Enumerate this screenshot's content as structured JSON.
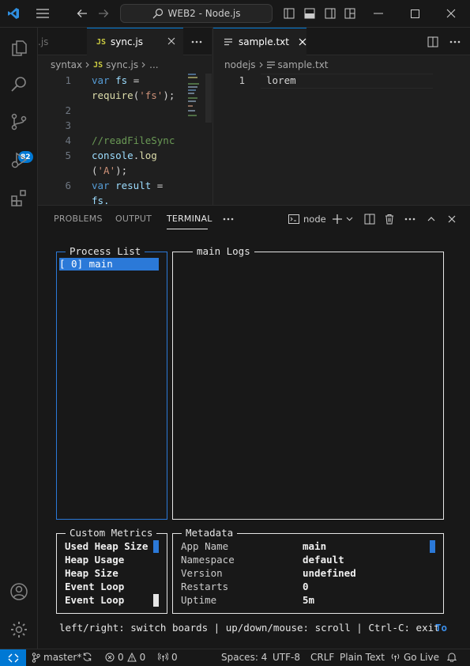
{
  "titlebar": {
    "search_text": "WEB2 - Node.js"
  },
  "activity": {
    "scm_badge": "82"
  },
  "editor1": {
    "tabs": [
      {
        "label": ".js"
      },
      {
        "icon": "JS",
        "label": "sync.js"
      }
    ],
    "breadcrumb": {
      "folder": "syntax",
      "file": "sync.js",
      "more": "..."
    },
    "line_numbers": [
      "1",
      "2",
      "3",
      "4",
      "5",
      "6"
    ],
    "code": {
      "l1a": "var",
      "l1b": " fs ",
      "l1c": "=",
      "l1d": "require",
      "l1e": "(",
      "l1f": "'fs'",
      "l1g": ");",
      "l4": "//readFileSync",
      "l5a": "console",
      "l5b": ".",
      "l5c": "log",
      "l5d": "(",
      "l5e": "'A'",
      "l5f": ");",
      "l6a": "var",
      "l6b": " result ",
      "l6c": "=",
      "l6d": "fs."
    }
  },
  "editor2": {
    "tab_label": "sample.txt",
    "breadcrumb": {
      "folder": "nodejs",
      "file": "sample.txt"
    },
    "line_number": "1",
    "content": "lorem"
  },
  "panel": {
    "tabs": [
      "PROBLEMS",
      "OUTPUT",
      "TERMINAL"
    ],
    "active_tab": "TERMINAL",
    "terminal_name": "node"
  },
  "terminal": {
    "process_list_title": "Process List",
    "process_item": "[ 0] main",
    "logs_title": "main Logs",
    "metrics_title": "Custom Metrics",
    "metrics": [
      "Used Heap Size",
      "Heap Usage",
      "Heap Size",
      "Event Loop",
      "Event Loop"
    ],
    "metadata_title": "Metadata",
    "metadata": [
      {
        "key": "App Name",
        "value": "main"
      },
      {
        "key": "Namespace",
        "value": "default"
      },
      {
        "key": "Version",
        "value": "undefined"
      },
      {
        "key": "Restarts",
        "value": "0"
      },
      {
        "key": "Uptime",
        "value": "5m"
      }
    ],
    "help": "left/right: switch boards | up/down/mouse: scroll | Ctrl-C: exit",
    "help_tail": "To"
  },
  "statusbar": {
    "branch": "master*",
    "errors": "0",
    "warnings": "0",
    "ports": "0",
    "spaces": "Spaces: 4",
    "encoding": "UTF-8",
    "eol": "CRLF",
    "language": "Plain Text",
    "golive": "Go Live"
  },
  "colors": {
    "accent": "#0078d4",
    "selection": "#2b79d8",
    "background": "#1f1f1f"
  }
}
